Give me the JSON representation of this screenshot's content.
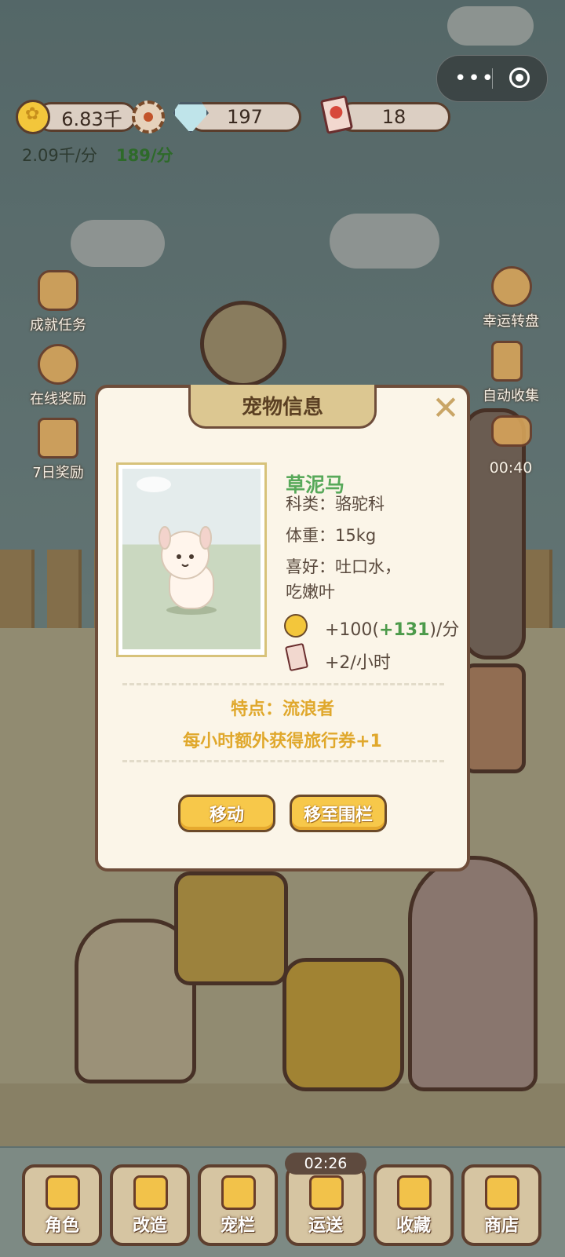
{
  "capsule": {
    "more_icon": "more-dots-icon",
    "close_icon": "target-icon"
  },
  "currency": {
    "coins": "6.83千",
    "gems": "197",
    "tickets": "18",
    "coin_rate": "2.09千/分",
    "bonus_rate": "189/分"
  },
  "side_left": [
    {
      "label": "成就任务",
      "icon": "flower-badge-icon"
    },
    {
      "label": "在线奖励",
      "icon": "clock-icon"
    },
    {
      "label": "7日奖励",
      "icon": "calendar-icon"
    }
  ],
  "side_right": [
    {
      "label": "幸运转盘",
      "icon": "wheel-icon"
    },
    {
      "label": "自动收集",
      "icon": "hourglass-icon"
    },
    {
      "label": "00:40",
      "icon": "food-bowl-icon"
    }
  ],
  "modal": {
    "title": "宠物信息",
    "close_icon": "close-icon",
    "pet_name": "草泥马",
    "family": "科类：骆驼科",
    "weight": "体重：15kg",
    "likes_line1": "喜好：吐口水，",
    "likes_line2": "吃嫩叶",
    "coin_prefix": "+100(",
    "coin_bonus": "+131",
    "coin_suffix": ")/分",
    "ticket_income": "+2/小时",
    "trait_title": "特点：流浪者",
    "trait_desc": "每小时额外获得旅行券+1",
    "btn_move": "移动",
    "btn_pen": "移至围栏"
  },
  "nav": {
    "timer": "02:26",
    "items": [
      {
        "label": "角色",
        "icon": "shirt-icon"
      },
      {
        "label": "改造",
        "icon": "blocks-icon"
      },
      {
        "label": "宠栏",
        "icon": "fence-icon"
      },
      {
        "label": "运送",
        "icon": "truck-icon"
      },
      {
        "label": "收藏",
        "icon": "chest-icon"
      },
      {
        "label": "商店",
        "icon": "cart-icon"
      }
    ]
  }
}
